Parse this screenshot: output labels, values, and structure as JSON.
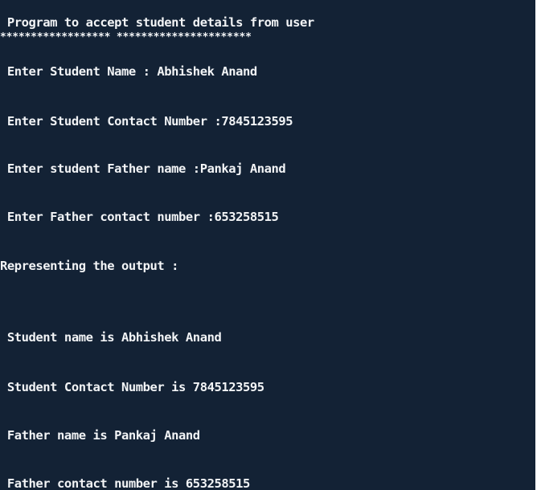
{
  "console": {
    "lines": [
      " Program to accept student details from user",
      "****************** **********************",
      " Enter Student Name : Abhishek Anand",
      " Enter Student Contact Number :7845123595",
      " Enter student Father name :Pankaj Anand",
      " Enter Father contact number :653258515",
      "Representing the output :",
      " Student name is Abhishek Anand",
      " Student Contact Number is 7845123595",
      " Father name is Pankaj Anand",
      " Father contact number is 653258515"
    ]
  }
}
